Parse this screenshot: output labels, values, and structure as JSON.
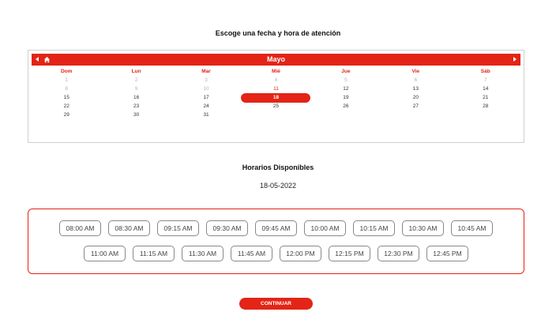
{
  "title": "Escoge una fecha y hora de atención",
  "calendar": {
    "month": "Mayo",
    "weekdays": [
      "Dom",
      "Lun",
      "Mar",
      "Mié",
      "Jue",
      "Vie",
      "Sáb"
    ],
    "weeks": [
      [
        "1",
        "2",
        "3",
        "4",
        "5",
        "6",
        "7"
      ],
      [
        "8",
        "9",
        "10",
        "11",
        "12",
        "13",
        "14"
      ],
      [
        "15",
        "16",
        "17",
        "18",
        "19",
        "20",
        "21"
      ],
      [
        "22",
        "23",
        "24",
        "25",
        "26",
        "27",
        "28"
      ],
      [
        "29",
        "30",
        "31",
        "",
        "",
        "",
        ""
      ]
    ],
    "selected_day": "18",
    "accent_color": "#e32416"
  },
  "horarios": {
    "title": "Horarios Disponibles",
    "date": "18-05-2022",
    "row1": [
      "08:00 AM",
      "08:30 AM",
      "09:15 AM",
      "09:30 AM",
      "09:45 AM",
      "10:00 AM",
      "10:15 AM",
      "10:30 AM",
      "10:45 AM"
    ],
    "row2": [
      "11:00 AM",
      "11:15 AM",
      "11:30 AM",
      "11:45 AM",
      "12:00 PM",
      "12:15 PM",
      "12:30 PM",
      "12:45 PM"
    ]
  },
  "continue_label": "CONTINUAR",
  "icons": {
    "prev": "chevron-left-icon",
    "home": "home-icon",
    "next": "chevron-right-icon"
  }
}
